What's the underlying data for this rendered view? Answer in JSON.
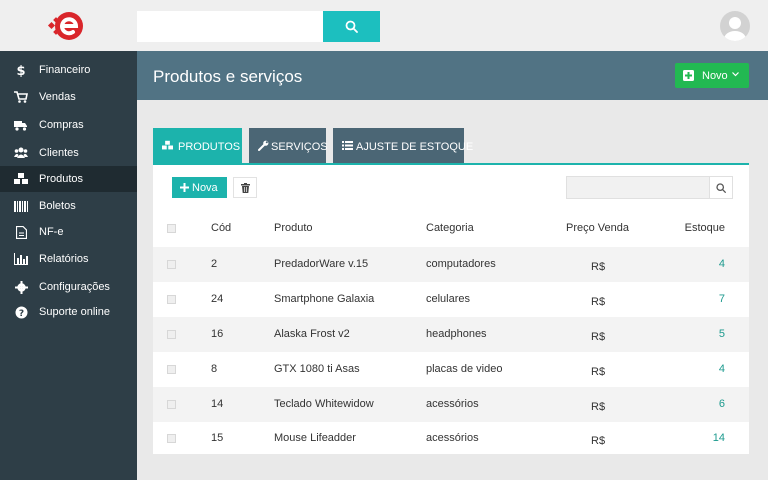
{
  "search": {
    "value": ""
  },
  "sidebar": {
    "items": [
      {
        "label": "Financeiro",
        "icon": "dollar-icon"
      },
      {
        "label": "Vendas",
        "icon": "cart-icon"
      },
      {
        "label": "Compras",
        "icon": "truck-icon"
      },
      {
        "label": "Clientes",
        "icon": "users-icon"
      },
      {
        "label": "Produtos",
        "icon": "cubes-icon",
        "active": true
      },
      {
        "label": "Boletos",
        "icon": "barcode-icon"
      },
      {
        "label": "NF-e",
        "icon": "file-icon"
      },
      {
        "label": "Relatórios",
        "icon": "bar-chart-icon"
      },
      {
        "label": "Configurações",
        "icon": "gear-icon"
      },
      {
        "label": "Suporte online",
        "icon": "question-icon"
      }
    ]
  },
  "header": {
    "title": "Produtos e serviços",
    "novo_label": "Novo"
  },
  "tabs": [
    {
      "label": "PRODUTOS",
      "icon": "cubes-icon",
      "active": true
    },
    {
      "label": "SERVIÇOS",
      "icon": "wrench-icon"
    },
    {
      "label": "AJUSTE DE ESTOQUE",
      "icon": "list-icon"
    }
  ],
  "toolbar": {
    "nova_label": "Nova",
    "search_value": ""
  },
  "table": {
    "headers": [
      "Cód",
      "Produto",
      "Categoria",
      "Preço Venda",
      "Estoque"
    ],
    "rows": [
      {
        "cod": "2",
        "produto": "PredadorWare v.15",
        "categoria": "computadores",
        "preco": "R$",
        "estoque": "4"
      },
      {
        "cod": "24",
        "produto": "Smartphone Galaxia",
        "categoria": "celulares",
        "preco": "R$",
        "estoque": "7"
      },
      {
        "cod": "16",
        "produto": "Alaska Frost v2",
        "categoria": "headphones",
        "preco": "R$",
        "estoque": "5"
      },
      {
        "cod": "8",
        "produto": "GTX 1080 ti Asas",
        "categoria": "placas de video",
        "preco": "R$",
        "estoque": "4"
      },
      {
        "cod": "14",
        "produto": "Teclado Whitewidow",
        "categoria": "acessórios",
        "preco": "R$",
        "estoque": "6"
      },
      {
        "cod": "15",
        "produto": "Mouse Lifeadder",
        "categoria": "acessórios",
        "preco": "R$",
        "estoque": "14"
      }
    ]
  },
  "colors": {
    "accent_teal": "#1cb3ac",
    "sidebar_bg": "#2e3e47",
    "header_bg": "#517384",
    "novo_green": "#22b952",
    "logo_red": "#d9262b"
  }
}
